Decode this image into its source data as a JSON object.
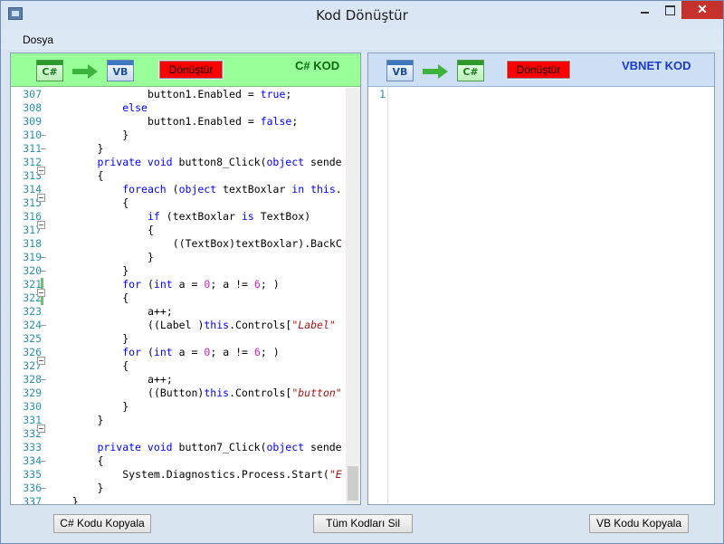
{
  "window": {
    "title": "Kod Dönüştür"
  },
  "menu": {
    "file": "Dosya"
  },
  "left_panel": {
    "source_icon": "csharp-file-icon",
    "target_icon": "vb-file-icon",
    "source_icon_text": "C#",
    "target_icon_text": "VB",
    "convert_label": "Dönüştür",
    "language_label": "C# KOD",
    "line_numbers": [
      "307",
      "308",
      "309",
      "310",
      "311",
      "312",
      "313",
      "314",
      "315",
      "316",
      "317",
      "318",
      "319",
      "320",
      "321",
      "322",
      "323",
      "324",
      "325",
      "326",
      "327",
      "328",
      "329",
      "330",
      "331",
      "332",
      "333",
      "334",
      "335",
      "336",
      "337"
    ],
    "code_lines": [
      "                button1.Enabled = true;",
      "            else",
      "                button1.Enabled = false;",
      "            }",
      "        }",
      "        private void button8_Click(object sende",
      "        {",
      "            foreach (object textBoxlar in this.",
      "            {",
      "                if (textBoxlar is TextBox)",
      "                {",
      "                    ((TextBox)textBoxlar).BackC",
      "                }",
      "            }",
      "            for (int a = 0; a != 6; )",
      "            {",
      "                a++;",
      "                ((Label )this.Controls[\"Label\"",
      "            }",
      "            for (int a = 0; a != 6; )",
      "            {",
      "                a++;",
      "                ((Button)this.Controls[\"button\"",
      "            }",
      "        }",
      "",
      "        private void button7_Click(object sende",
      "        {",
      "            System.Diagnostics.Process.Start(\"E",
      "        }",
      "    }"
    ]
  },
  "right_panel": {
    "source_icon": "vb-file-icon",
    "target_icon": "csharp-file-icon",
    "source_icon_text": "VB",
    "target_icon_text": "C#",
    "convert_label": "Dönüştür",
    "language_label": "VBNET KOD",
    "line_numbers": [
      "1"
    ]
  },
  "buttons": {
    "copy_csharp": "C# Kodu Kopyala",
    "clear_all": "Tüm Kodları Sil",
    "copy_vb": "VB Kodu Kopyala"
  },
  "colors": {
    "csharp_toolbar": "#99ff99",
    "vb_toolbar": "#ccdff4",
    "convert_button": "#ff0000",
    "keyword": "#0000ff",
    "string": "#a31515",
    "number": "#d11fd1",
    "line_number": "#2b91af"
  }
}
